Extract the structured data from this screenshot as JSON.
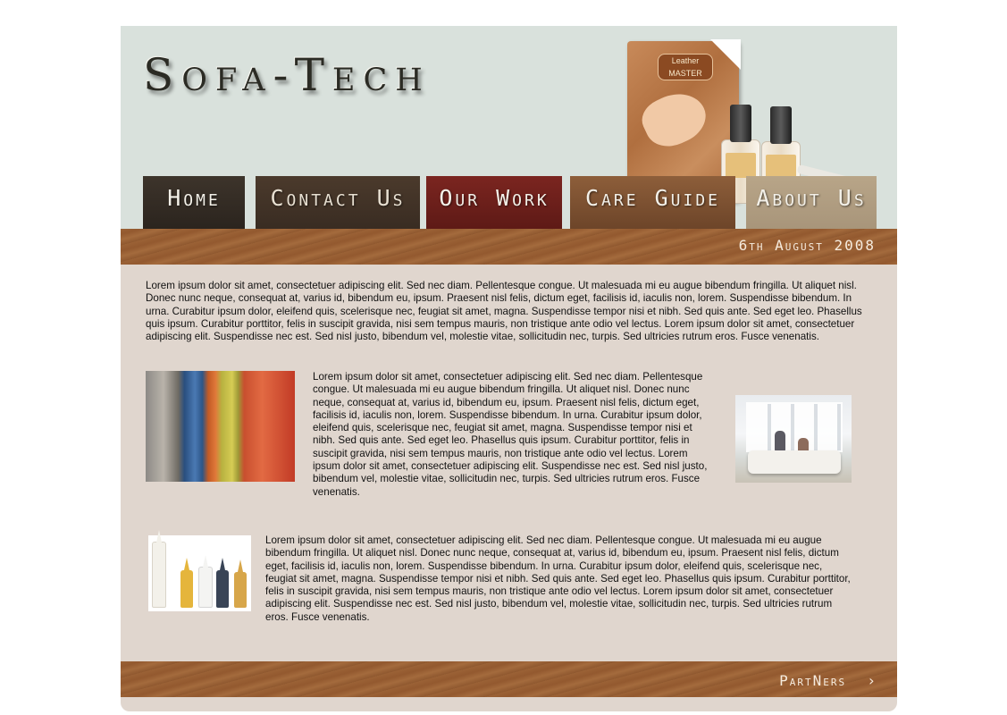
{
  "site": {
    "logo": "Sofa-Tech"
  },
  "product": {
    "brand": "Leather MASTER"
  },
  "nav": {
    "items": [
      {
        "label": "Home"
      },
      {
        "label": "Contact Us"
      },
      {
        "label": "Our Work"
      },
      {
        "label": "Care Guide"
      },
      {
        "label": "About Us"
      }
    ]
  },
  "header_band": {
    "date": "6th August 2008"
  },
  "content": {
    "paragraph1": "Lorem ipsum dolor sit amet, consectetuer adipiscing elit. Sed nec diam. Pellentesque congue. Ut malesuada mi eu augue bibendum fringilla. Ut aliquet nisl. Donec nunc neque, consequat at, varius id, bibendum eu, ipsum. Praesent nisl felis, dictum eget, facilisis id, iaculis non, lorem. Suspendisse bibendum. In urna. Curabitur ipsum dolor, eleifend quis, scelerisque nec, feugiat sit amet, magna. Suspendisse tempor nisi et nibh. Sed quis ante. Sed eget leo. Phasellus quis ipsum. Curabitur porttitor, felis in suscipit gravida, nisi sem tempus mauris, non tristique ante odio vel lectus. Lorem ipsum dolor sit amet, consectetuer adipiscing elit. Suspendisse nec est. Sed nisl justo, bibendum vel, molestie vitae, sollicitudin nec, turpis. Sed ultricies rutrum eros. Fusce venenatis.",
    "paragraph2": "Lorem ipsum dolor sit amet, consectetuer adipiscing elit. Sed nec diam. Pellentesque congue. Ut malesuada mi eu augue bibendum fringilla. Ut aliquet nisl. Donec nunc neque, consequat at, varius id, bibendum eu, ipsum. Praesent nisl felis, dictum eget, facilisis id, iaculis non, lorem. Suspendisse bibendum. In urna. Curabitur ipsum dolor, eleifend quis, scelerisque nec, feugiat sit amet, magna. Suspendisse tempor nisi et nibh. Sed quis ante. Sed eget leo. Phasellus quis ipsum. Curabitur porttitor, felis in suscipit gravida, nisi sem tempus mauris, non tristique ante odio vel lectus. Lorem ipsum dolor sit amet, consectetuer adipiscing elit. Suspendisse nec est. Sed nisl justo, bibendum vel, molestie vitae, sollicitudin nec, turpis. Sed ultricies rutrum eros. Fusce venenatis.",
    "paragraph3": "Lorem ipsum dolor sit amet, consectetuer adipiscing elit. Sed nec diam. Pellentesque congue. Ut malesuada mi eu augue bibendum fringilla. Ut aliquet nisl. Donec nunc neque, consequat at, varius id, bibendum eu, ipsum. Praesent nisl felis, dictum eget, facilisis id, iaculis non, lorem. Suspendisse bibendum. In urna. Curabitur ipsum dolor, eleifend quis, scelerisque nec, feugiat sit amet, magna. Suspendisse tempor nisi et nibh. Sed quis ante. Sed eget leo. Phasellus quis ipsum. Curabitur porttitor, felis in suscipit gravida, nisi sem tempus mauris, non tristique ante odio vel lectus. Lorem ipsum dolor sit amet, consectetuer adipiscing elit. Suspendisse nec est. Sed nisl justo, bibendum vel, molestie vitae, sollicitudin nec, turpis. Sed ultricies rutrum eros. Fusce venenatis."
  },
  "footer_band": {
    "partners_label": "PartNers",
    "partners_icon": "chevron-right-icon"
  },
  "colors": {
    "header_bg": "#d9e1dc",
    "content_bg": "#e0d6ce",
    "band_brown": "#9b6236",
    "tab_home": "#3d342b",
    "tab_contact": "#4b3a2c",
    "tab_work": "#7b2520",
    "tab_care": "#8d5e3a",
    "tab_about": "#b8a588"
  }
}
